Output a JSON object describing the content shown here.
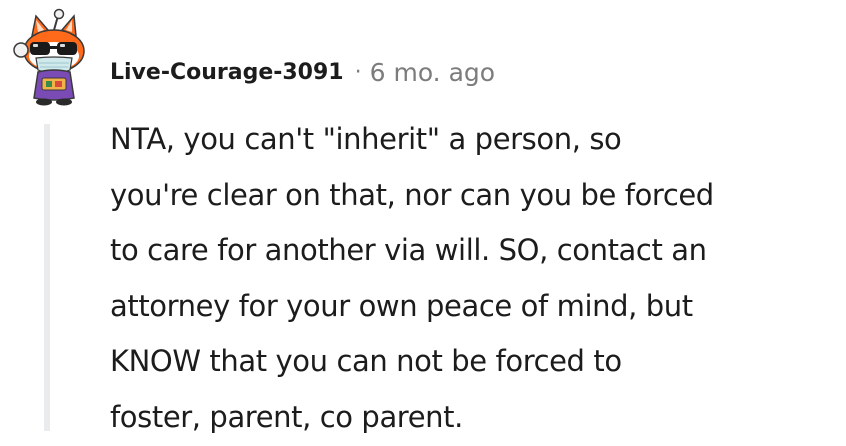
{
  "comment": {
    "author": "Live-Courage-3091",
    "separator": "·",
    "timestamp": "6 mo. ago",
    "avatar_icon": "snoo-avatar-icon",
    "body_lines": [
      "NTA, you can't \"inherit\" a person, so",
      "you're clear on that, nor can you be forced",
      "to care for another via will. SO, contact an",
      "attorney for your own peace of mind, but",
      "KNOW that you can not be forced to",
      "foster, parent, co parent."
    ]
  },
  "colors": {
    "text": "#1c1c1c",
    "meta_text": "#7c7c7c",
    "thread_line": "#e9ebed",
    "background": "#ffffff"
  }
}
